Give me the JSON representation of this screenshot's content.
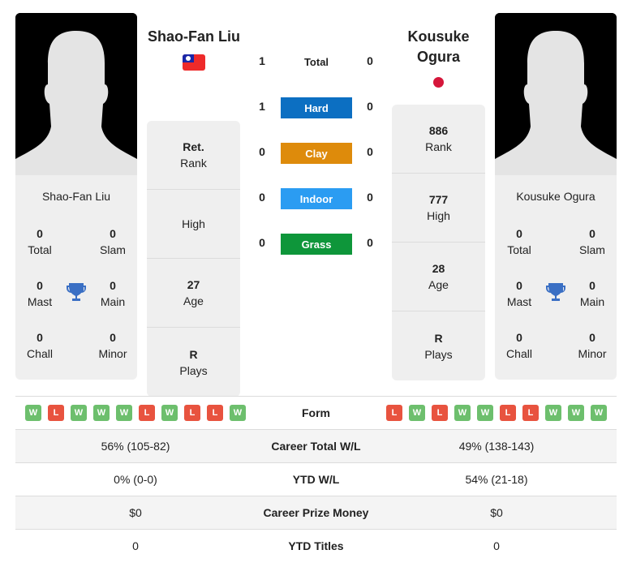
{
  "player1": {
    "name": "Shao-Fan Liu",
    "flag": "taiwan-flag",
    "titles": {
      "total": "0",
      "slam": "0",
      "mast": "0",
      "main": "0",
      "chall": "0",
      "minor": "0"
    },
    "rank": "Ret.",
    "high": "",
    "age": "27",
    "plays": "R",
    "form": [
      "W",
      "L",
      "W",
      "W",
      "W",
      "L",
      "W",
      "L",
      "L",
      "W"
    ],
    "career_wl": "56% (105-82)",
    "ytd_wl": "0% (0-0)",
    "prize": "$0",
    "ytd_titles": "0"
  },
  "player2": {
    "name": "Kousuke Ogura",
    "name_line1": "Kousuke",
    "name_line2": "Ogura",
    "flag": "japan-flag",
    "titles": {
      "total": "0",
      "slam": "0",
      "mast": "0",
      "main": "0",
      "chall": "0",
      "minor": "0"
    },
    "rank": "886",
    "high": "777",
    "age": "28",
    "plays": "R",
    "form": [
      "L",
      "W",
      "L",
      "W",
      "W",
      "L",
      "L",
      "W",
      "W",
      "W"
    ],
    "career_wl": "49% (138-143)",
    "ytd_wl": "54% (21-18)",
    "prize": "$0",
    "ytd_titles": "0"
  },
  "labels": {
    "total": "Total",
    "slam": "Slam",
    "mast": "Mast",
    "main": "Main",
    "chall": "Chall",
    "minor": "Minor",
    "rank": "Rank",
    "high": "High",
    "age": "Age",
    "plays": "Plays",
    "form": "Form",
    "career_wl": "Career Total W/L",
    "ytd_wl": "YTD W/L",
    "prize": "Career Prize Money",
    "ytd_titles": "YTD Titles"
  },
  "h2h": {
    "total": {
      "label": "Total",
      "p1": "1",
      "p2": "0"
    },
    "surfaces": [
      {
        "label": "Hard",
        "p1": "1",
        "p2": "0",
        "color": "#0c6fc2"
      },
      {
        "label": "Clay",
        "p1": "0",
        "p2": "0",
        "color": "#de8b0b"
      },
      {
        "label": "Indoor",
        "p1": "0",
        "p2": "0",
        "color": "#2b9cf2"
      },
      {
        "label": "Grass",
        "p1": "0",
        "p2": "0",
        "color": "#0e963a"
      }
    ]
  }
}
